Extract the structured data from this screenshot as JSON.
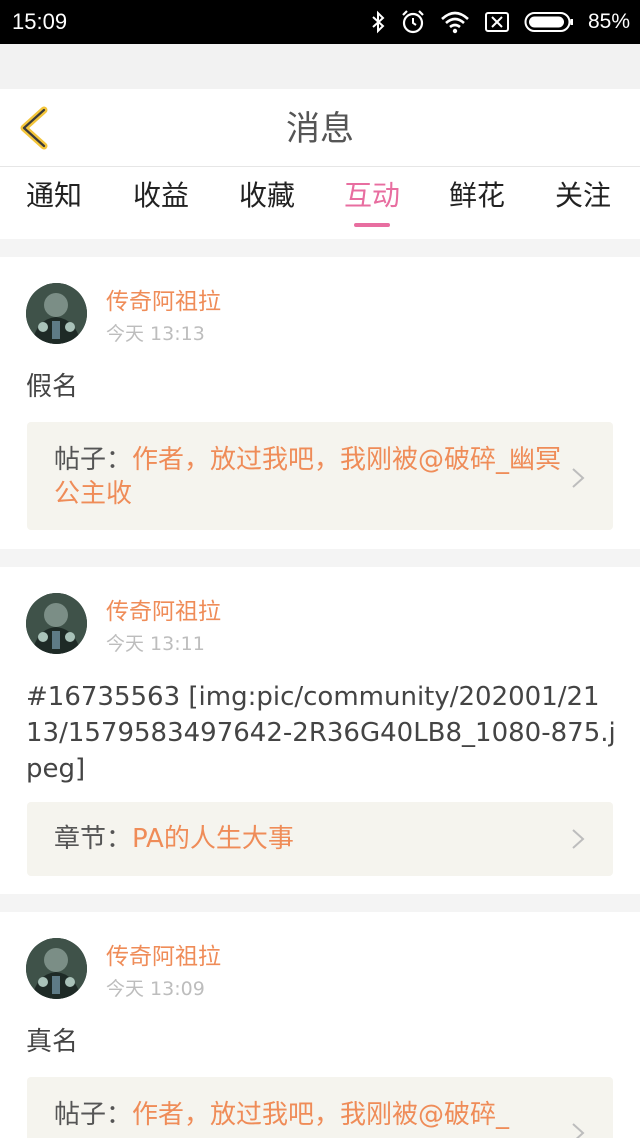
{
  "status_bar": {
    "time": "15:09",
    "battery": "85%",
    "icons": [
      "bluetooth-icon",
      "alarm-icon",
      "wifi-icon",
      "no-sim-icon",
      "battery-icon"
    ]
  },
  "header": {
    "title": "消息",
    "back_icon": "chevron-left-icon"
  },
  "tabs": [
    {
      "label": "通知",
      "active": false
    },
    {
      "label": "收益",
      "active": false
    },
    {
      "label": "收藏",
      "active": false
    },
    {
      "label": "互动",
      "active": true
    },
    {
      "label": "鲜花",
      "active": false
    },
    {
      "label": "关注",
      "active": false
    }
  ],
  "colors": {
    "accent": "#e86ea0",
    "username": "#ef8c58",
    "reference_bg": "#f5f4ee"
  },
  "messages": [
    {
      "user": "传奇阿祖拉",
      "time": "今天 13:13",
      "text": "假名",
      "ref_prefix": "帖子：",
      "ref_title": "作者，放过我吧，我刚被@破碎_幽冥公主收"
    },
    {
      "user": "传奇阿祖拉",
      "time": "今天 13:11",
      "text": "#16735563 [img:pic/community/202001/2113/1579583497642-2R36G40LB8_1080-875.jpeg]",
      "ref_prefix": "章节：",
      "ref_title": "PA的人生大事"
    },
    {
      "user": "传奇阿祖拉",
      "time": "今天 13:09",
      "text": "真名",
      "ref_prefix": "帖子：",
      "ref_title": "作者，放过我吧，我刚被@破碎_"
    }
  ]
}
